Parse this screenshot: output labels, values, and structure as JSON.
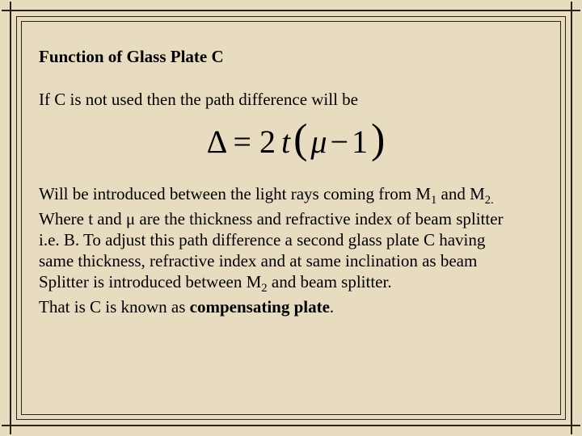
{
  "title": "Function of Glass Plate C",
  "intro": "If C is not used then the path difference will be",
  "equation": {
    "delta": "Δ",
    "eq": "=",
    "two": "2",
    "t": "t",
    "lparen": "(",
    "mu": "μ",
    "minus": "−",
    "one": "1",
    "rparen": ")"
  },
  "body": {
    "line1_a": "Will be introduced between the light rays coming from M",
    "line1_sub1": "1",
    "line1_b": " and M",
    "line1_sub2": "2.",
    "line2": "Where t and μ are the thickness and refractive index of beam splitter",
    "line3": " i.e. B. To adjust this path difference a second glass plate C having",
    "line4": "same thickness, refractive index and at same inclination as beam",
    "line5_a": "Splitter is introduced between M",
    "line5_sub": "2",
    "line5_b": " and beam splitter.",
    "line6_a": "That is C is known as ",
    "line6_bold": "compensating plate",
    "line6_b": "."
  }
}
